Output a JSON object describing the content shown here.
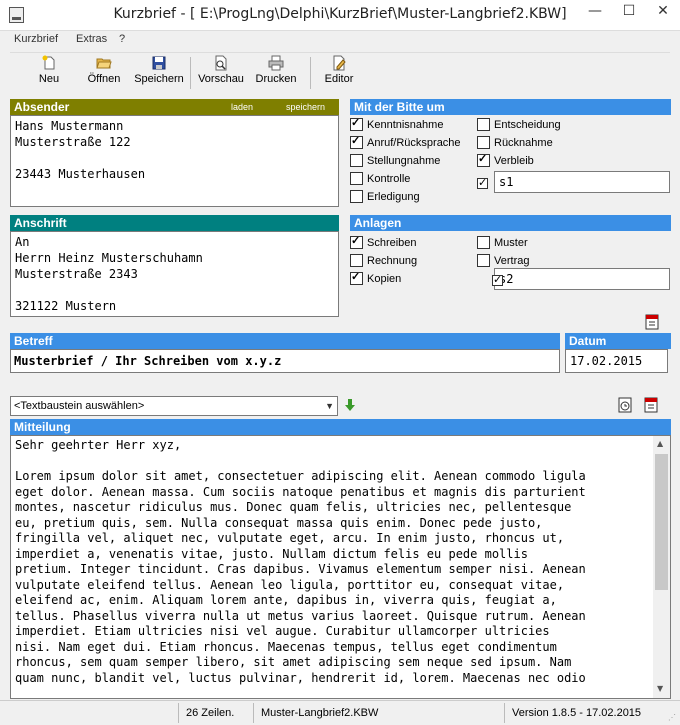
{
  "window": {
    "title": "Kurzbrief - [ E:\\ProgLng\\Delphi\\KurzBrief\\Muster-Langbrief2.KBW]",
    "minimize_glyph": "—",
    "maximize_glyph": "☐",
    "close_glyph": "✕"
  },
  "menu": [
    "Kurzbrief",
    "Extras",
    "?"
  ],
  "toolbar": {
    "neu": "Neu",
    "oeffnen": "Öffnen",
    "speichern": "Speichern",
    "vorschau": "Vorschau",
    "drucken": "Drucken",
    "editor": "Editor"
  },
  "absender": {
    "header": "Absender",
    "laden": "laden",
    "speichern": "speichern",
    "text": "Hans Mustermann\nMusterstraße 122\n\n23443 Musterhausen"
  },
  "anschrift": {
    "header": "Anschrift",
    "text": "An\nHerrn Heinz Musterschuhamn\nMusterstraße 2343\n\n321122 Mustern"
  },
  "bitte": {
    "header": "Mit der Bitte um",
    "left": [
      {
        "label": "Kenntnisnahme",
        "checked": true
      },
      {
        "label": "Anruf/Rücksprache",
        "checked": true
      },
      {
        "label": "Stellungnahme",
        "checked": false
      },
      {
        "label": "Kontrolle",
        "checked": false
      },
      {
        "label": "Erledigung",
        "checked": false
      }
    ],
    "right": [
      {
        "label": "Entscheidung",
        "checked": false
      },
      {
        "label": "Rücknahme",
        "checked": false
      },
      {
        "label": "Verbleib",
        "checked": true
      }
    ],
    "custom_checked": true,
    "custom_value": "s1"
  },
  "anlagen": {
    "header": "Anlagen",
    "left": [
      {
        "label": "Schreiben",
        "checked": true
      },
      {
        "label": "Rechnung",
        "checked": false
      },
      {
        "label": "Kopien",
        "checked": true
      }
    ],
    "right": [
      {
        "label": "Muster",
        "checked": false
      },
      {
        "label": "Vertrag",
        "checked": false
      }
    ],
    "custom_checked": true,
    "custom_value": "s2"
  },
  "betreff": {
    "header": "Betreff",
    "value": "Musterbrief / Ihr Schreiben vom x.y.z"
  },
  "datum": {
    "header": "Datum",
    "value": "17.02.2015"
  },
  "textbaustein": {
    "value": "<Textbaustein auswählen>"
  },
  "mitteilung": {
    "header": "Mitteilung",
    "text": "Sehr geehrter Herr xyz,\n\nLorem ipsum dolor sit amet, consectetuer adipiscing elit. Aenean commodo ligula\neget dolor. Aenean massa. Cum sociis natoque penatibus et magnis dis parturient\nmontes, nascetur ridiculus mus. Donec quam felis, ultricies nec, pellentesque\neu, pretium quis, sem. Nulla consequat massa quis enim. Donec pede justo,\nfringilla vel, aliquet nec, vulputate eget, arcu. In enim justo, rhoncus ut,\nimperdiet a, venenatis vitae, justo. Nullam dictum felis eu pede mollis\npretium. Integer tincidunt. Cras dapibus. Vivamus elementum semper nisi. Aenean\nvulputate eleifend tellus. Aenean leo ligula, porttitor eu, consequat vitae,\neleifend ac, enim. Aliquam lorem ante, dapibus in, viverra quis, feugiat a,\ntellus. Phasellus viverra nulla ut metus varius laoreet. Quisque rutrum. Aenean\nimperdiet. Etiam ultricies nisi vel augue. Curabitur ullamcorper ultricies\nnisi. Nam eget dui. Etiam rhoncus. Maecenas tempus, tellus eget condimentum\nrhoncus, sem quam semper libero, sit amet adipiscing sem neque sed ipsum. Nam\nquam nunc, blandit vel, luctus pulvinar, hendrerit id, lorem. Maecenas nec odio"
  },
  "status": {
    "zeilen": "26 Zeilen.",
    "file": "Muster-Langbrief2.KBW",
    "version": "Version 1.8.5 - 17.02.2015"
  }
}
